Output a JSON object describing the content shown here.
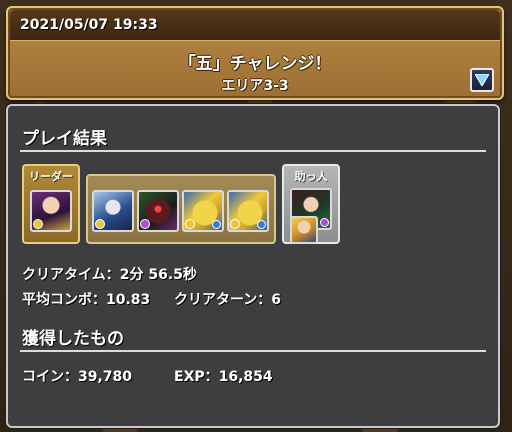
{
  "header": {
    "datetime": "2021/05/07 19:33",
    "title": "「五」チャレンジ！",
    "subtitle": "エリア3-3"
  },
  "result": {
    "section_title": "プレイ結果",
    "team": {
      "leader_label": "リーダー",
      "helper_label": "助っ人",
      "leader": {
        "icon": "witch-monster-icon"
      },
      "subs": [
        {
          "icon": "blue-haired-monster-icon"
        },
        {
          "icon": "dark-demon-monster-icon"
        },
        {
          "icon": "gold-dragon-monster-icon"
        },
        {
          "icon": "gold-dragon-monster-icon"
        }
      ],
      "helper": {
        "icon": "swordsman-monster-icon"
      },
      "helper_assist": {
        "icon": "blond-swordsman-monster-icon"
      }
    },
    "clear_time": "クリアタイム：2分 56.5秒",
    "avg_combo": "平均コンボ：10.83",
    "clear_turns": "クリアターン：6"
  },
  "rewards": {
    "section_title": "獲得したもの",
    "coin": "コイン：39,780",
    "exp": "EXP：16,854"
  },
  "colors": {
    "header_bg": "#ad7f3e",
    "panel_bg": "#3e3e40",
    "leader_frame": "#b08a3a",
    "helper_frame": "#b5b5b5"
  }
}
